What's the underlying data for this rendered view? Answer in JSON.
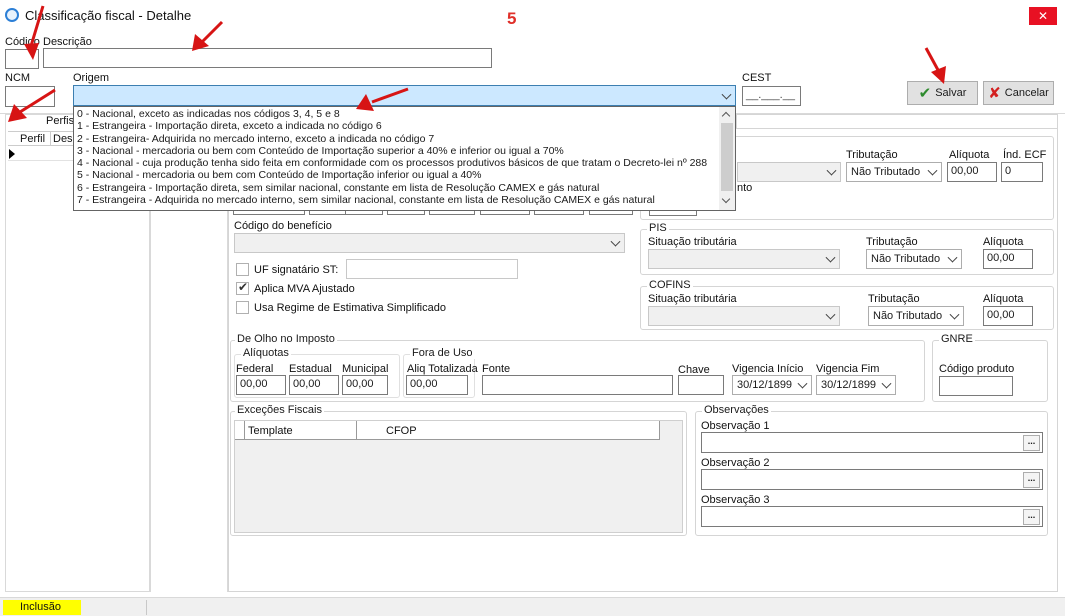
{
  "window": {
    "title": "Classificação fiscal - Detalhe",
    "step_marker": "5",
    "close_label": "✕"
  },
  "fields": {
    "codigo_label": "Código",
    "descricao_label": "Descrição",
    "ncm_label": "NCM",
    "origem_label": "Origem",
    "cest_label": "CEST",
    "cest_value": "__.___.__",
    "origem_value": ""
  },
  "buttons": {
    "save_label": "Salvar",
    "cancel_label": "Cancelar"
  },
  "origem_options": [
    "0 - Nacional, exceto as indicadas nos códigos 3, 4, 5 e 8",
    "1 - Estrangeira - Importação direta, exceto a indicada no código 6",
    "2 - Estrangeira- Adquirida no mercado interno, exceto a indicada no código 7",
    "3 - Nacional - mercadoria ou bem com Conteúdo de Importação superior a 40% e inferior ou igual a 70%",
    "4 - Nacional - cuja produção tenha sido feita em conformidade com os processos produtivos básicos de que tratam o Decreto-lei nº 288",
    "5 - Nacional - mercadoria ou bem com Conteúdo de Importação inferior ou igual a 40%",
    "6 - Estrangeira - Importação direta, sem similar nacional, constante  em lista de Resolução CAMEX e gás natural",
    "7 - Estrangeira - Adquirida no mercado interno, sem similar nacional, constante em lista de Resolução CAMEX e gás natural"
  ],
  "perfis": {
    "title": "Perfis",
    "col_perfil": "Perfil",
    "col_desc": "Desc"
  },
  "icms": {
    "tributacao_label": "Tributação",
    "tributacao_value": "Não Tributado",
    "aliquota_label": "Alíquota",
    "aliquota_value": "00,00",
    "ind_ecf_label": "Índ. ECF",
    "ind_ecf_value": "0",
    "partial_label": "nto"
  },
  "beneficio": {
    "codigo_label": "Código do benefício",
    "uf_signatario_label": "UF signatário ST:",
    "aplica_mva_label": "Aplica MVA Ajustado",
    "usa_regime_label": "Usa Regime de Estimativa Simplificado"
  },
  "pis": {
    "title": "PIS",
    "situacao_label": "Situação tributária",
    "tributacao_label": "Tributação",
    "tributacao_value": "Não Tributado",
    "aliquota_label": "Alíquota",
    "aliquota_value": "00,00"
  },
  "cofins": {
    "title": "COFINS",
    "situacao_label": "Situação tributária",
    "tributacao_label": "Tributação",
    "tributacao_value": "Não Tributado",
    "aliquota_label": "Alíquota",
    "aliquota_value": "00,00"
  },
  "de_olho": {
    "title": "De Olho no Imposto",
    "aliquotas_title": "Alíquotas",
    "federal_label": "Federal",
    "federal_value": "00,00",
    "estadual_label": "Estadual",
    "estadual_value": "00,00",
    "municipal_label": "Municipal",
    "municipal_value": "00,00",
    "fora_uso_title": "Fora de Uso",
    "aliq_total_label": "Aliq Totalizada",
    "aliq_total_value": "00,00",
    "fonte_label": "Fonte",
    "chave_label": "Chave",
    "vig_inicio_label": "Vigencia Início",
    "vig_inicio_value": "30/12/1899",
    "vig_fim_label": "Vigencia Fim",
    "vig_fim_value": "30/12/1899"
  },
  "gnre": {
    "title": "GNRE",
    "codigo_produto_label": "Código produto"
  },
  "excecoes": {
    "title": "Exceções Fiscais",
    "col_template": "Template",
    "col_cfop": "CFOP"
  },
  "observacoes": {
    "title": "Observações",
    "obs1_label": "Observação 1",
    "obs2_label": "Observação 2",
    "obs3_label": "Observação 3",
    "dots": "..."
  },
  "status": {
    "mode": "Inclusão"
  },
  "colors": {
    "accent_red": "#e81123",
    "status_yellow": "#ffff00",
    "selection_blue": "#cce8ff",
    "annotation_red": "#d71414"
  }
}
